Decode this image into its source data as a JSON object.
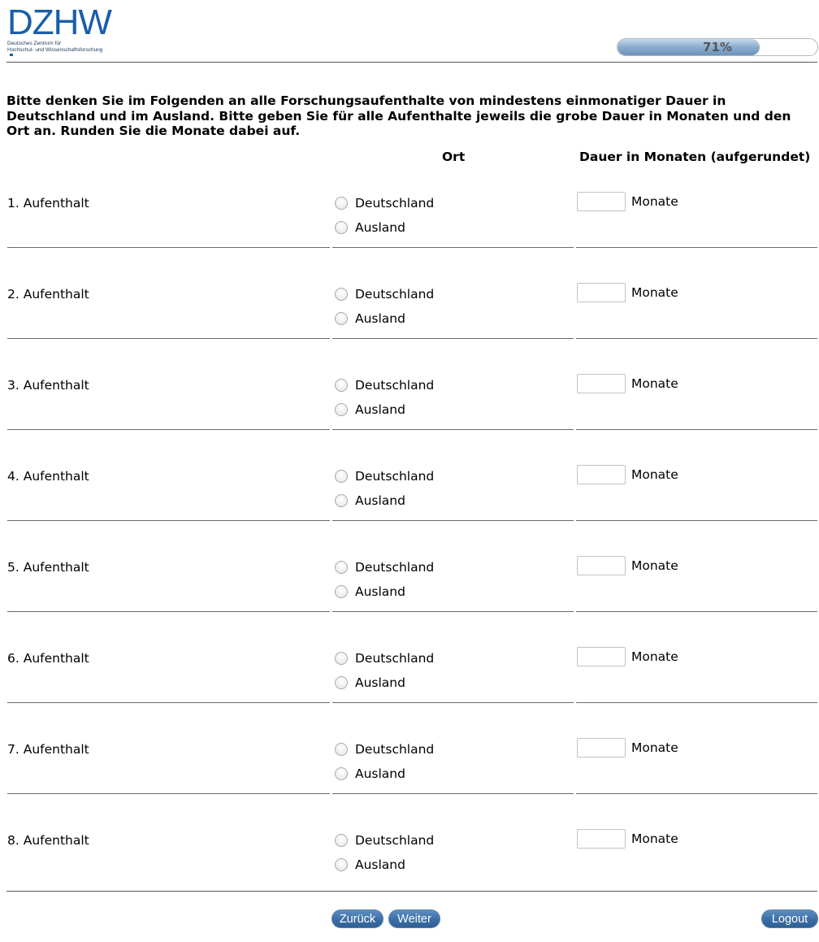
{
  "logo": {
    "mark": "DZHW",
    "line1": "Deutsches Zentrum für",
    "line2": "Hochschul- und Wissenschaftsforschung"
  },
  "progress": {
    "percent": 71,
    "label": "71%"
  },
  "question": "Bitte denken Sie im Folgenden an alle Forschungsaufenthalte von mindestens einmonatiger Dauer in Deutschland und im Ausland. Bitte geben Sie für alle Aufenthalte jeweils die grobe Dauer in Monaten und den Ort an. Runden Sie die Monate dabei auf.",
  "columns": {
    "ort": "Ort",
    "dauer": "Dauer in Monaten (aufgerundet)"
  },
  "rows": [
    {
      "label": "1. Aufenthalt",
      "opt1": "Deutschland",
      "opt2": "Ausland",
      "unit": "Monate",
      "value": ""
    },
    {
      "label": "2. Aufenthalt",
      "opt1": "Deutschland",
      "opt2": "Ausland",
      "unit": "Monate",
      "value": ""
    },
    {
      "label": "3. Aufenthalt",
      "opt1": "Deutschland",
      "opt2": "Ausland",
      "unit": "Monate",
      "value": ""
    },
    {
      "label": "4. Aufenthalt",
      "opt1": "Deutschland",
      "opt2": "Ausland",
      "unit": "Monate",
      "value": ""
    },
    {
      "label": "5. Aufenthalt",
      "opt1": "Deutschland",
      "opt2": "Ausland",
      "unit": "Monate",
      "value": ""
    },
    {
      "label": "6. Aufenthalt",
      "opt1": "Deutschland",
      "opt2": "Ausland",
      "unit": "Monate",
      "value": ""
    },
    {
      "label": "7. Aufenthalt",
      "opt1": "Deutschland",
      "opt2": "Ausland",
      "unit": "Monate",
      "value": ""
    },
    {
      "label": "8. Aufenthalt",
      "opt1": "Deutschland",
      "opt2": "Ausland",
      "unit": "Monate",
      "value": ""
    }
  ],
  "buttons": {
    "back": "Zurück",
    "next": "Weiter",
    "logout": "Logout"
  },
  "colors": {
    "brand": "#1a5ea8",
    "button": "#3b6ea6",
    "progress_fill": "#8eb0d0"
  }
}
